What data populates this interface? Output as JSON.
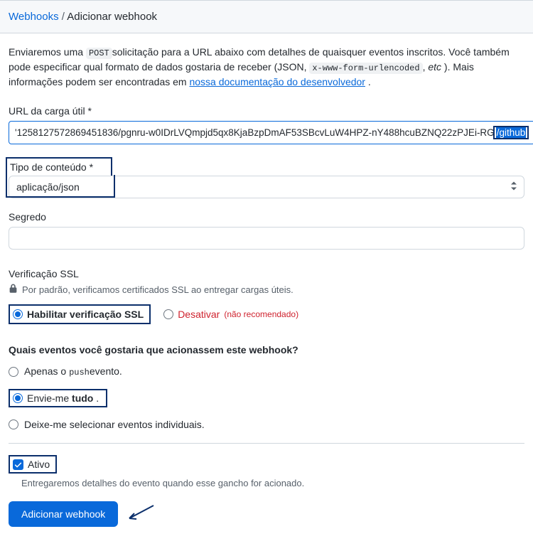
{
  "breadcrumb": {
    "root": "Webhooks",
    "sep": "/",
    "current": "Adicionar webhook"
  },
  "intro": {
    "p1a": "Enviaremos uma ",
    "code1": "POST",
    "p1b": "solicitação para a URL abaixo com detalhes de quaisquer eventos inscritos. Você também pode especificar qual formato de dados gostaria de receber (JSON, ",
    "code2": "x-www-form-urlencoded",
    "p1c": ", ",
    "em": "etc",
    "p1d": " ). Mais informações podem ser encontradas em ",
    "link": "nossa documentação do desenvolvedor",
    "p1e": " ."
  },
  "fields": {
    "payload_url": {
      "label": "URL da carga útil *",
      "value_prefix": "'1258127572869451836/pgnru-w0IDrLVQmpjd5qx8KjaBzpDmAF53SBcvLuW4HPZ-nY488hcuBZNQ22zPJEi-RG",
      "value_highlight": "/github"
    },
    "content_type": {
      "label": "Tipo de conteúdo *",
      "value": "aplicação/json"
    },
    "secret": {
      "label": "Segredo",
      "value": ""
    }
  },
  "ssl": {
    "title": "Verificação SSL",
    "note": "Por padrão, verificamos certificados SSL ao entregar cargas úteis.",
    "enable": "Habilitar verificação SSL",
    "disable": "Desativar",
    "not_recommended": "(não recomendado)"
  },
  "events": {
    "title": "Quais eventos você gostaria que acionassem este webhook?",
    "push_a": "Apenas o ",
    "push_code": "push",
    "push_b": "evento.",
    "everything_a": "Envie-me ",
    "everything_b": "tudo",
    "everything_c": " .",
    "individual": "Deixe-me selecionar eventos individuais."
  },
  "active": {
    "label": "Ativo",
    "note": "Entregaremos detalhes do evento quando esse gancho for acionado."
  },
  "submit": {
    "label": "Adicionar webhook"
  }
}
